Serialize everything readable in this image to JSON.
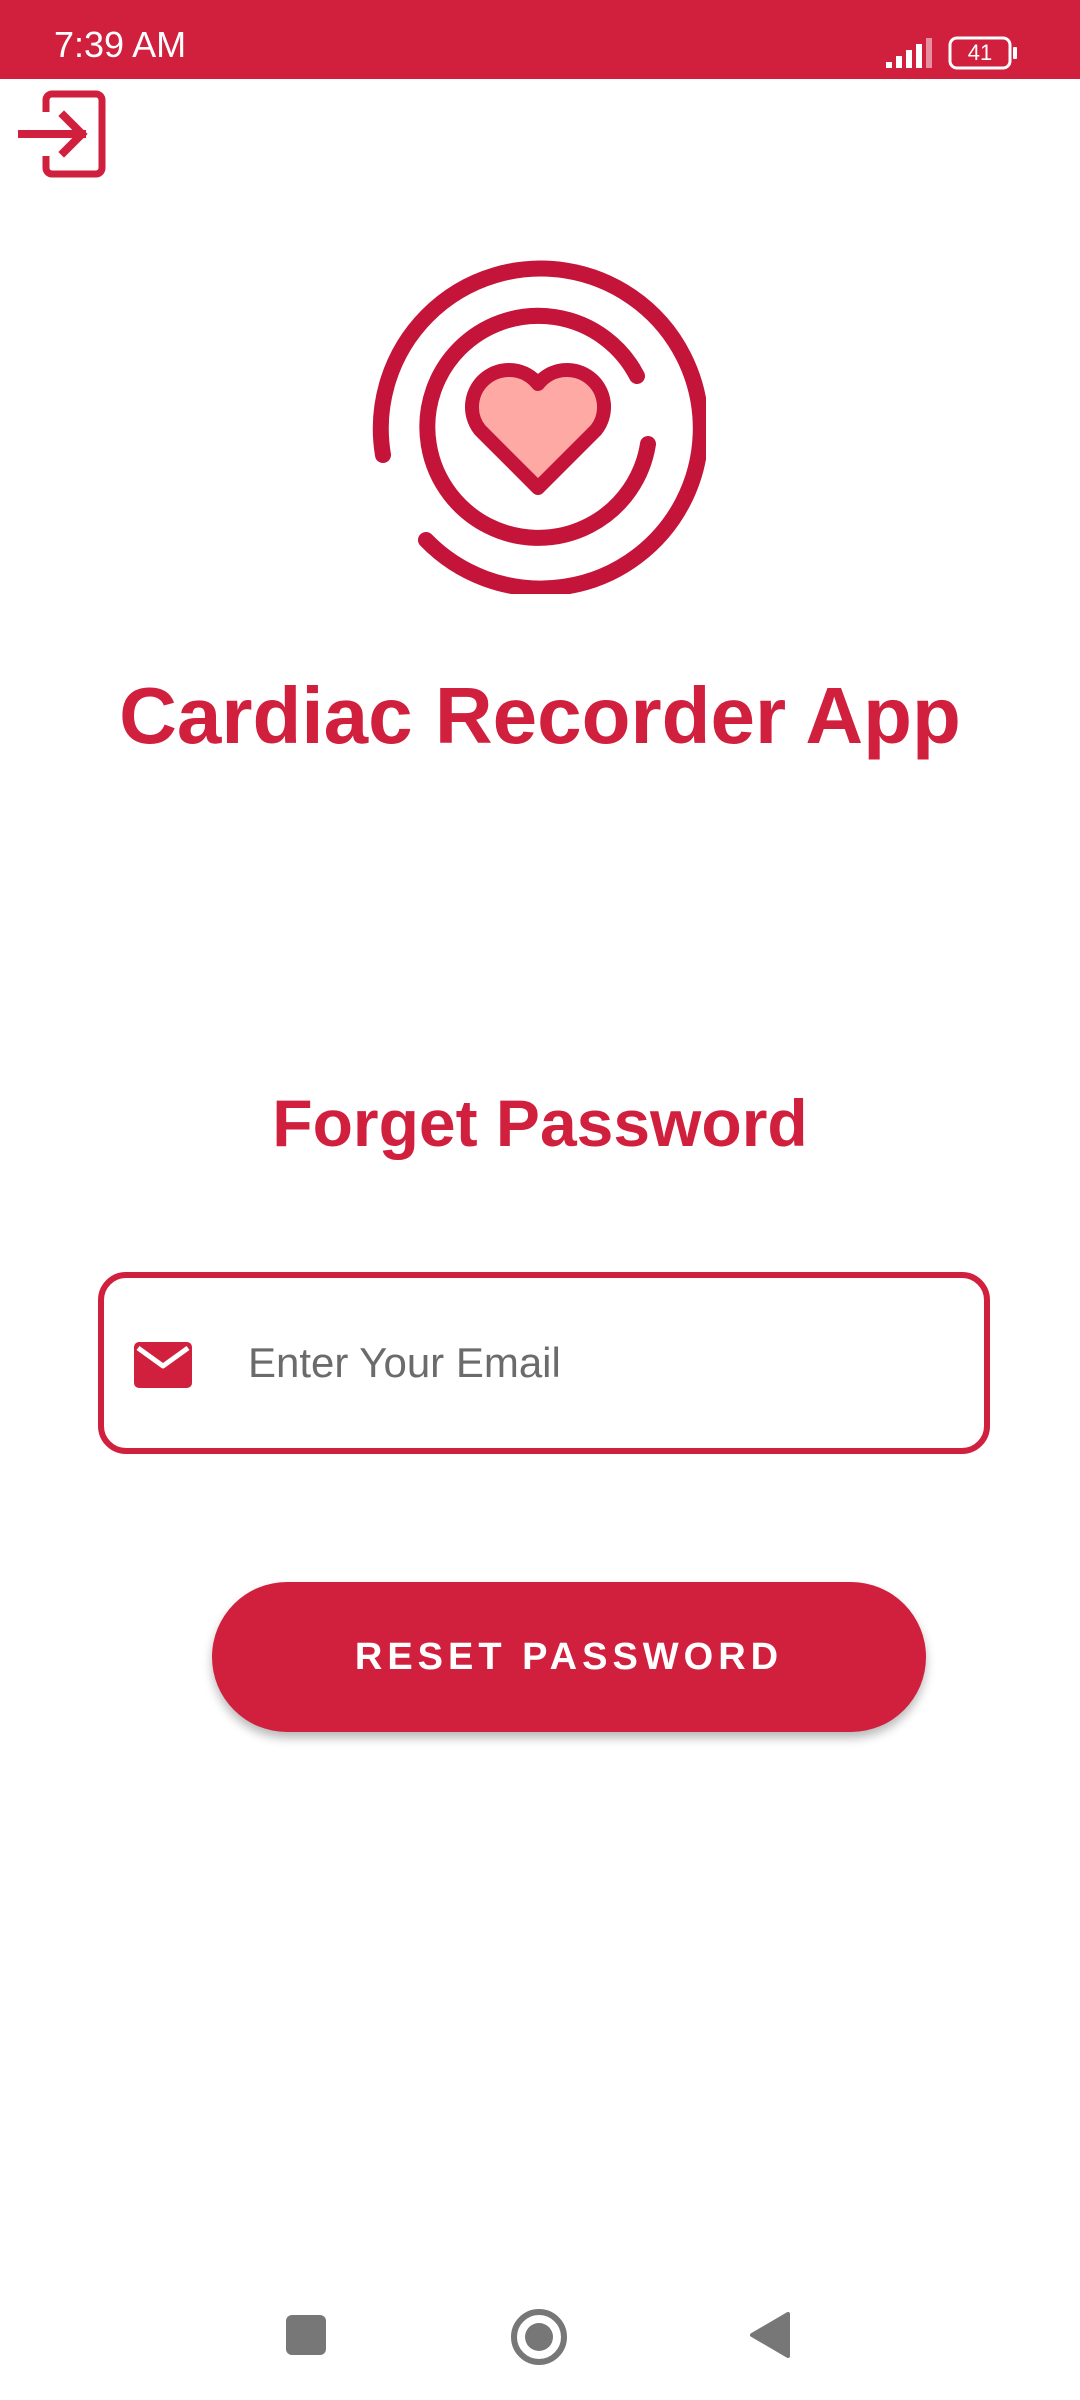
{
  "status_bar": {
    "time": "7:39 AM",
    "battery_level": "41",
    "background_color": "#D11F3E"
  },
  "top_icon": "login-icon",
  "app": {
    "title": "Cardiac Recorder App",
    "logo_icon": "heart-logo-icon",
    "brand_color": "#D11F3E",
    "heart_fill_color": "#FFA9A4"
  },
  "form": {
    "heading": "Forget Password",
    "email_placeholder": "Enter Your Email",
    "email_value": "",
    "email_icon": "mail-icon",
    "reset_button_label": "RESET PASSWORD"
  },
  "nav_bar": {
    "icons": [
      "recents-icon",
      "home-icon",
      "back-icon"
    ]
  }
}
